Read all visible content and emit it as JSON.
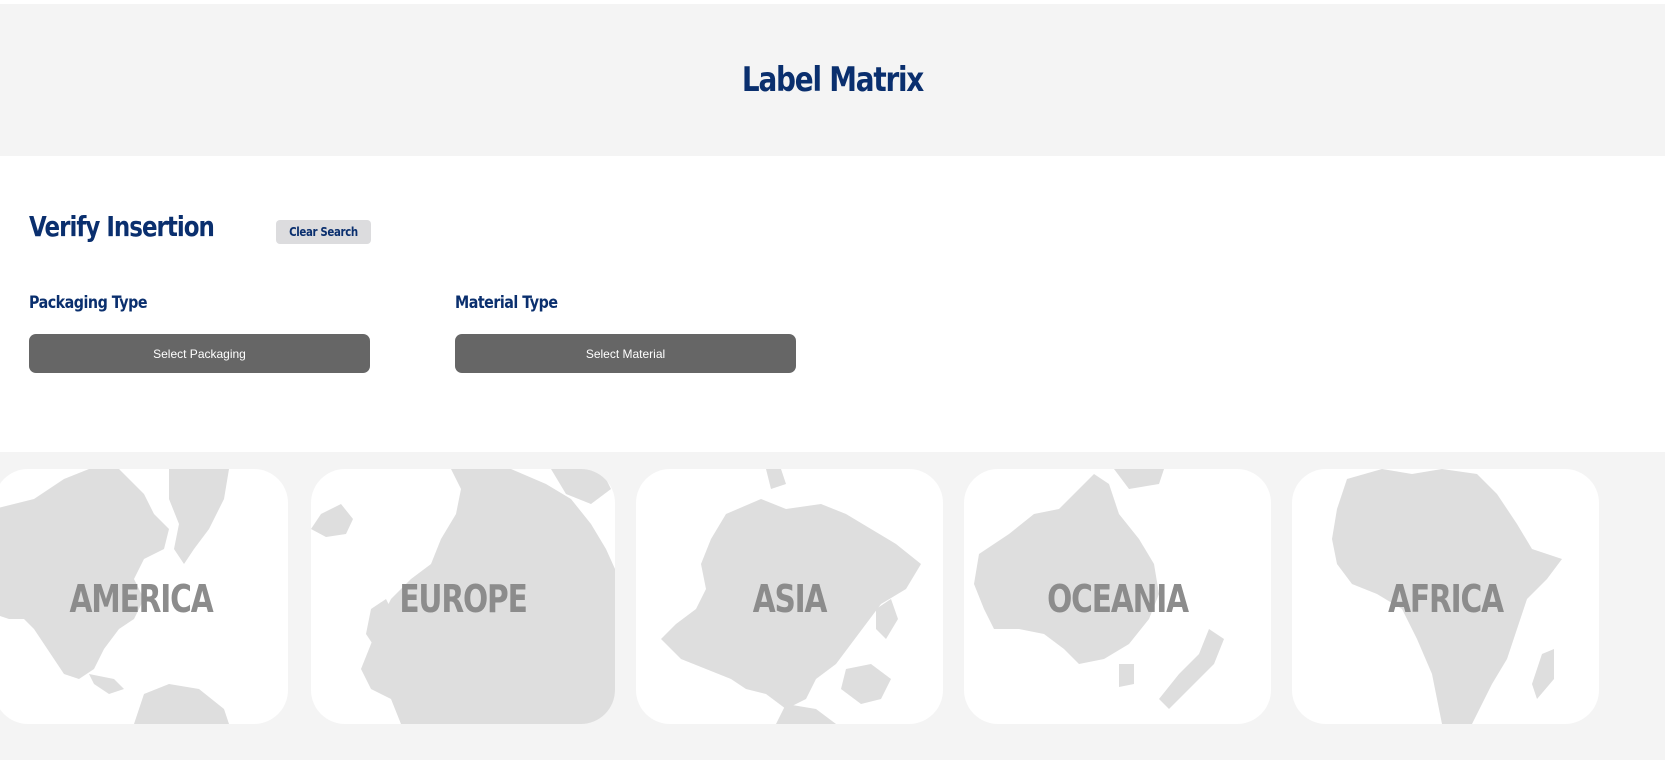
{
  "header": {
    "title": "Label Matrix"
  },
  "search": {
    "title": "Verify Insertion",
    "clear_label": "Clear Search",
    "packaging": {
      "label": "Packaging Type",
      "button": "Select Packaging"
    },
    "material": {
      "label": "Material Type",
      "button": "Select Material"
    }
  },
  "regions": [
    {
      "name": "AMERICA"
    },
    {
      "name": "EUROPE"
    },
    {
      "name": "ASIA"
    },
    {
      "name": "OCEANIA"
    },
    {
      "name": "AFRICA"
    }
  ],
  "colors": {
    "brand": "#0a2f6e",
    "header_bg": "#f4f4f4",
    "button_dark": "#666666",
    "button_light": "#dcdcde",
    "map_land": "#dedede",
    "region_label": "#8c8c8c"
  }
}
